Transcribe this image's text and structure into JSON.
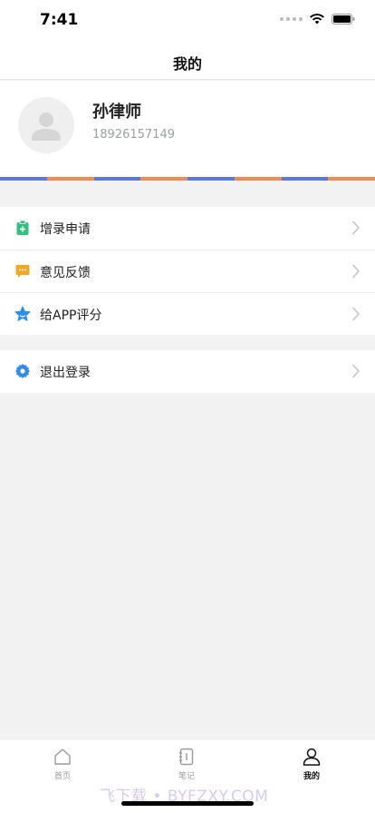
{
  "status_bar": {
    "time": "7:41"
  },
  "nav": {
    "title": "我的"
  },
  "profile": {
    "name": "孙律师",
    "phone": "18926157149"
  },
  "stripe_colors": [
    "#5b78e0",
    "#f28a53"
  ],
  "menu": {
    "group1": [
      {
        "label": "增录申请",
        "icon": "clipboard-plus-icon",
        "color": "#2ec27e"
      },
      {
        "label": "意见反馈",
        "icon": "chat-bubble-icon",
        "color": "#f5a623"
      },
      {
        "label": "给APP评分",
        "icon": "star-icon",
        "color": "#2b8cf2"
      }
    ],
    "group2": [
      {
        "label": "退出登录",
        "icon": "gear-icon",
        "color": "#2b8cf2"
      }
    ]
  },
  "tab_bar": {
    "tabs": [
      {
        "label": "首页",
        "icon": "home-icon",
        "active": false
      },
      {
        "label": "笔记",
        "icon": "notebook-icon",
        "active": false
      },
      {
        "label": "我的",
        "icon": "user-icon",
        "active": true
      }
    ],
    "watermark": "飞下载 • BYFZXY.COM"
  }
}
